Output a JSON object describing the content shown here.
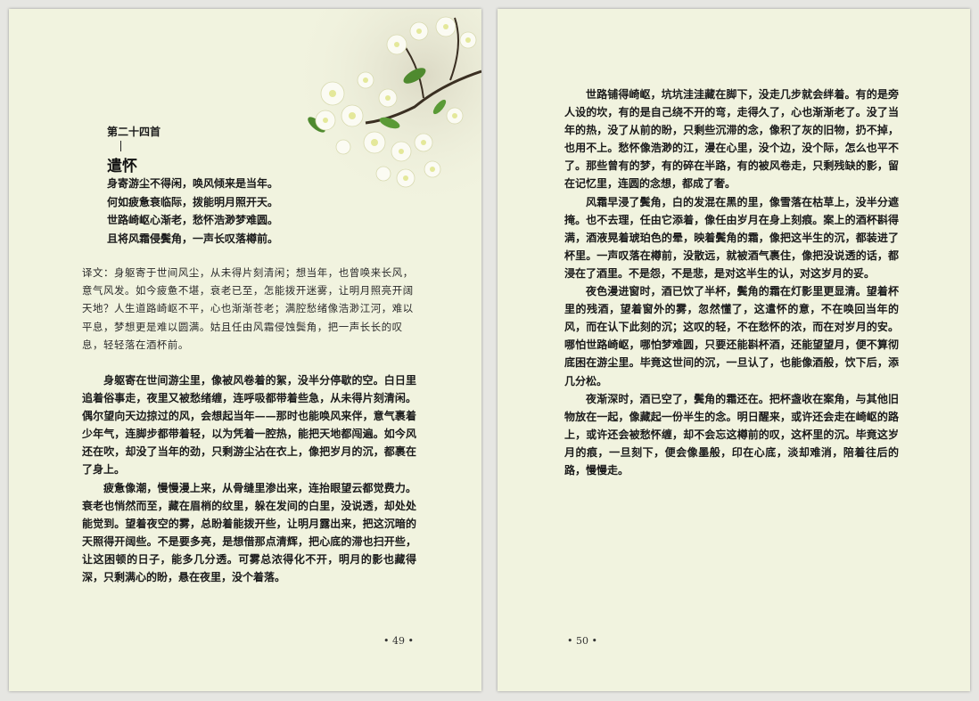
{
  "left_page": {
    "poem_number": "第二十四首",
    "poem_title": "遣怀",
    "poem_lines": [
      "身寄游尘不得闲，唤风倾来是当年。",
      "何如疲惫衰临际，拨能明月照开天。",
      "世路崎岖心渐老，愁怀浩渺梦难圆。",
      "且将风霜侵鬓角，一声长叹落樽前。"
    ],
    "translation": "译文：身躯寄于世间风尘，从未得片刻清闲；想当年，也曾唤来长风，意气风发。如今疲惫不堪，衰老已至，怎能拨开迷雾，让明月照亮开阔天地？人生道路崎岖不平，心也渐渐苍老；满腔愁绪像浩渺江河，难以平息，梦想更是难以圆满。姑且任由风霜侵蚀鬓角，把一声长长的叹息，轻轻落在酒杯前。",
    "paragraphs": [
      "身躯寄在世间游尘里，像被风卷着的絮，没半分停歇的空。白日里追着俗事走，夜里又被愁绪缠，连呼吸都带着些急，从未得片刻清闲。偶尔望向天边掠过的风，会想起当年——那时也能唤风来伴，意气裹着少年气，连脚步都带着轻，以为凭着一腔热，能把天地都闯遍。如今风还在吹，却没了当年的劲，只剩游尘沾在衣上，像把岁月的沉，都裹在了身上。",
      "疲惫像潮，慢慢漫上来，从骨缝里渗出来，连抬眼望云都觉费力。衰老也悄然而至，藏在眉梢的纹里，躲在发间的白里，没说透，却处处能觉到。望着夜空的雾，总盼着能拨开些，让明月露出来，把这沉暗的天照得开阔些。不是要多亮，是想借那点清辉，把心底的滞也扫开些，让这困顿的日子，能多几分透。可雾总浓得化不开，明月的影也藏得深，只剩满心的盼，悬在夜里，没个着落。"
    ],
    "page_number": "• 49 •"
  },
  "right_page": {
    "paragraphs": [
      "世路铺得崎岖，坑坑洼洼藏在脚下，没走几步就会绊着。有的是旁人设的坎，有的是自己绕不开的弯，走得久了，心也渐渐老了。没了当年的热，没了从前的盼，只剩些沉滞的念，像积了灰的旧物，扔不掉，也用不上。愁怀像浩渺的江，漫在心里，没个边，没个际，怎么也平不了。那些曾有的梦，有的碎在半路，有的被风卷走，只剩残缺的影，留在记忆里，连圆的念想，都成了奢。",
      "风霜早浸了鬓角，白的发混在黑的里，像雪落在枯草上，没半分遮掩。也不去理，任由它添着，像任由岁月在身上刻痕。案上的酒杯斟得满，酒液晃着琥珀色的晕，映着鬓角的霜，像把这半生的沉，都装进了杯里。一声叹落在樽前，没散远，就被酒气裹住，像把没说透的话，都浸在了酒里。不是怨，不是悲，是对这半生的认，对这岁月的妥。",
      "夜色漫进窗时，酒已饮了半杯，鬓角的霜在灯影里更显清。望着杯里的残酒，望着窗外的雾，忽然懂了，这遣怀的意，不在唤回当年的风，而在认下此刻的沉；这叹的轻，不在愁怀的浓，而在对岁月的安。哪怕世路崎岖，哪怕梦难圆，只要还能斟杯酒，还能望望月，便不算彻底困在游尘里。毕竟这世间的沉，一旦认了，也能像酒般，饮下后，添几分松。",
      "夜渐深时，酒已空了，鬓角的霜还在。把杯盏收在案角，与其他旧物放在一起，像藏起一份半生的念。明日醒来，或许还会走在崎岖的路上，或许还会被愁怀缠，却不会忘这樽前的叹，这杯里的沉。毕竟这岁月的痕，一旦刻下，便会像墨般，印在心底，淡却难消，陪着往后的路，慢慢走。"
    ],
    "page_number": "• 50 •"
  },
  "decoration": {
    "illustration": "white-blossom-branch",
    "page_color": "#f1f3df"
  }
}
